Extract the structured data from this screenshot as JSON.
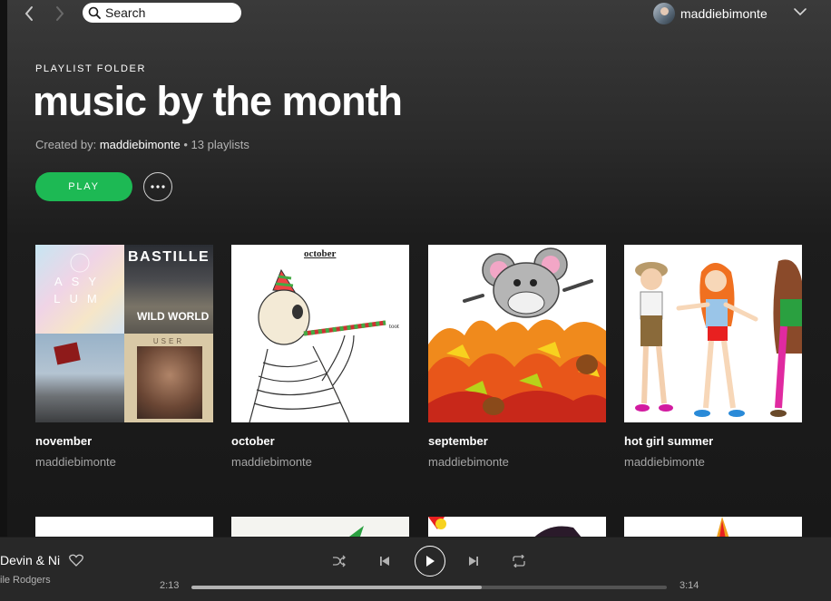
{
  "topbar": {
    "search_placeholder": "Search",
    "username": "maddiebimonte"
  },
  "header": {
    "eyebrow": "PLAYLIST FOLDER",
    "title": "music by the month",
    "created_by_label": "Created by:",
    "owner": "maddiebimonte",
    "count": "13 playlists",
    "play_label": "PLAY"
  },
  "cards": [
    {
      "title": "november",
      "subtitle": "maddiebimonte",
      "mosaic": {
        "t1": "ASY LUM",
        "t2a": "BASTILLE",
        "t2b": "WILD WORLD",
        "t4": "USER"
      }
    },
    {
      "title": "october",
      "subtitle": "maddiebimonte",
      "cover_text": "october",
      "cover_text2": "toot"
    },
    {
      "title": "september",
      "subtitle": "maddiebimonte"
    },
    {
      "title": "hot girl summer",
      "subtitle": "maddiebimonte"
    }
  ],
  "player": {
    "track": "Devin & Ni",
    "artist": "ile Rodgers",
    "elapsed": "2:13",
    "total": "3:14",
    "progress": 0.61
  },
  "colors": {
    "accent": "#1db954",
    "background": "#181818",
    "player_bg": "#282828"
  }
}
